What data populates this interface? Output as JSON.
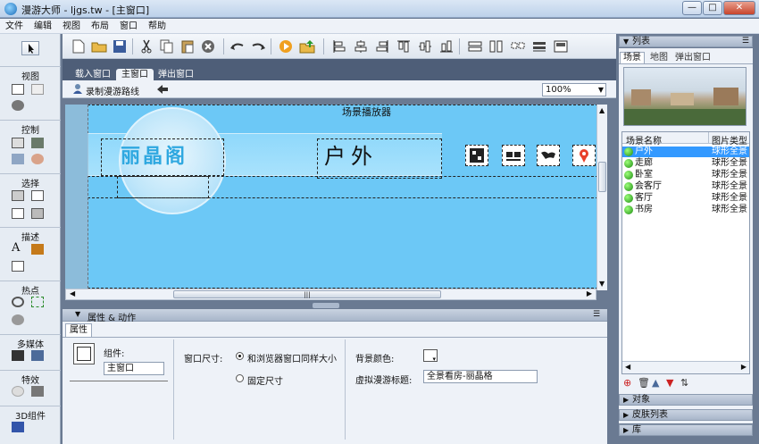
{
  "window": {
    "title": "漫游大师 - ljgs.tw - [主窗口]",
    "min": "—",
    "max": "□",
    "close": "✕"
  },
  "menu": [
    "文件",
    "编辑",
    "视图",
    "布局",
    "窗口",
    "帮助"
  ],
  "left_sections": [
    "视图",
    "控制",
    "选择",
    "描述",
    "热点",
    "多媒体",
    "特效",
    "3D组件"
  ],
  "tabs": [
    "载入窗口",
    "主窗口",
    "弹出窗口"
  ],
  "subtool": {
    "record": "录制漫游路线",
    "zoom": "100%"
  },
  "stage": {
    "title": "场景播放器",
    "logo": "丽晶阁",
    "scene": "户外",
    "scroll_mark": "|||"
  },
  "prop_panel": {
    "header": "属性 & 动作",
    "tab": "属性",
    "component_label": "组件:",
    "component_value": "主窗口",
    "window_size_label": "窗口尺寸:",
    "radio1": "和浏览器窗口同样大小",
    "radio2": "固定尺寸",
    "bg_color_label": "背景颜色:",
    "tour_title_label": "虚拟漫游标题:",
    "tour_title_value": "全景看房-丽晶格"
  },
  "right": {
    "list_header": "列表",
    "tabs": [
      "场景",
      "地图",
      "弹出窗口"
    ],
    "col1": "场景名称",
    "col2": "图片类型",
    "scenes": [
      {
        "name": "户外",
        "type": "球形全景",
        "selected": true
      },
      {
        "name": "走廊",
        "type": "球形全景",
        "selected": false
      },
      {
        "name": "卧室",
        "type": "球形全景",
        "selected": false
      },
      {
        "name": "会客厅",
        "type": "球形全景",
        "selected": false
      },
      {
        "name": "客厅",
        "type": "球形全景",
        "selected": false
      },
      {
        "name": "书房",
        "type": "球形全景",
        "selected": false
      }
    ],
    "bottom": [
      "对象",
      "皮肤列表",
      "库"
    ]
  },
  "colors": {
    "accent": "#3399ff",
    "stage": "#6cc8f6",
    "chrome": "#6a7a92"
  }
}
